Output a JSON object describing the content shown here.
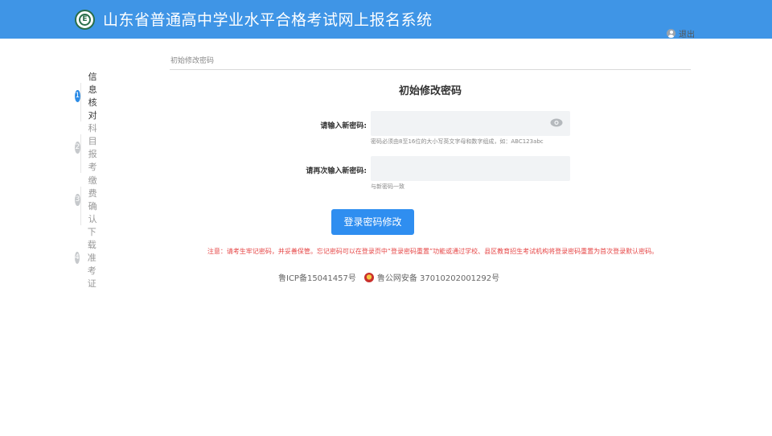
{
  "header": {
    "title": "山东省普通高中学业水平合格考试网上报名系统",
    "logo_glyph": "E",
    "logout_label": "退出",
    "background_color": "#3f95e6"
  },
  "steps": [
    {
      "number": "1",
      "label": "信息核对",
      "active": true
    },
    {
      "number": "2",
      "label": "科目报考",
      "active": false
    },
    {
      "number": "3",
      "label": "缴费确认",
      "active": false
    },
    {
      "number": "4",
      "label": "下载准考证",
      "active": false
    }
  ],
  "breadcrumb": "初始修改密码",
  "form": {
    "heading": "初始修改密码",
    "new_password_label": "请输入新密码:",
    "new_password_value": "",
    "new_password_hint": "密码必须由8至16位的大小写英文字母和数字组成，如：ABC123abc",
    "confirm_password_label": "请再次输入新密码:",
    "confirm_password_value": "",
    "confirm_password_hint": "与新密码一致",
    "submit_label": "登录密码修改"
  },
  "notice": "注意：请考生牢记密码，并妥善保管。忘记密码可以在登录页中“登录密码重置”功能或通过学校、县区教育招生考试机构将登录密码重置为首次登录默认密码。",
  "footer": {
    "icp": "鲁ICP备15041457号",
    "police_record": "鲁公网安备 37010202001292号"
  },
  "colors": {
    "accent": "#2f8ef0",
    "active_step": "#2d8ce6",
    "notice": "#e64646"
  }
}
